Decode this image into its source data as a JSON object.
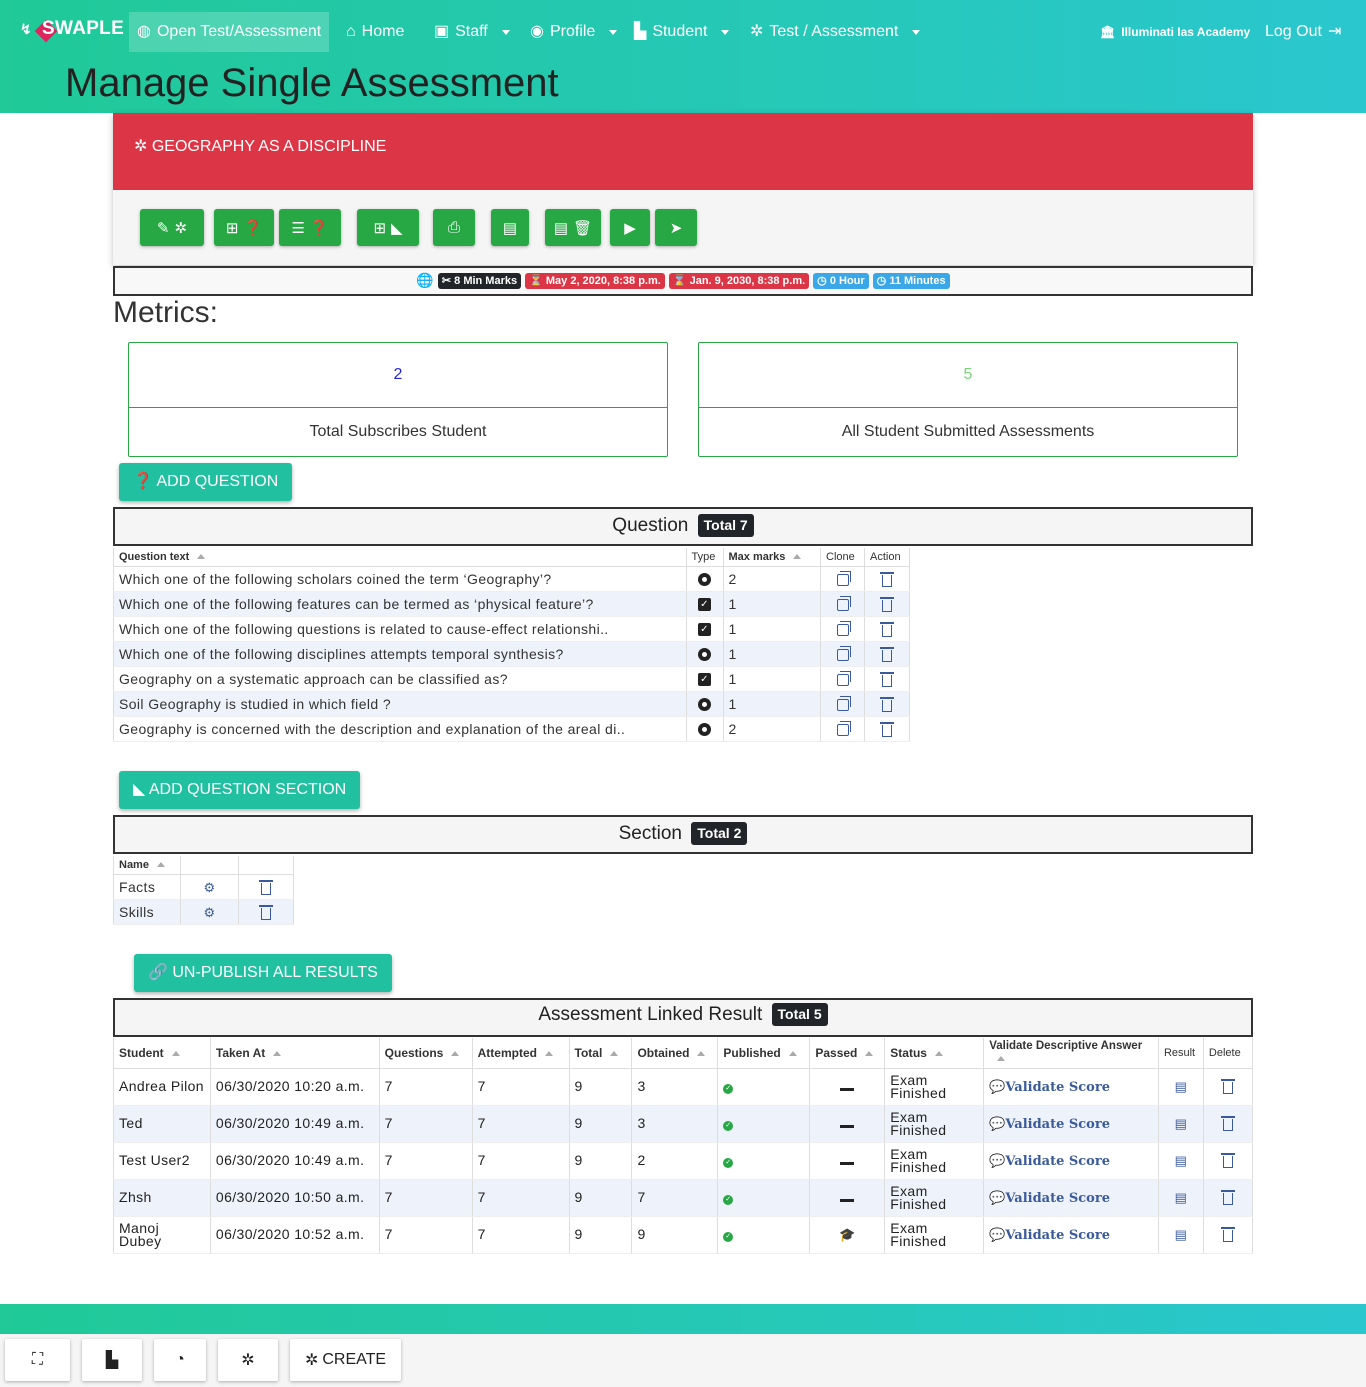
{
  "nav": {
    "brand": "SWAPLE",
    "open_test": "Open Test/Assessment",
    "home": "Home",
    "staff": "Staff",
    "profile": "Profile",
    "student": "Student",
    "test": "Test / Assessment",
    "academy": "Illuminati Ias Academy",
    "logout": "Log Out"
  },
  "page_title": "Manage Single Assessment",
  "assessment": {
    "title": "GEOGRAPHY AS A DISCIPLINE",
    "min_marks": "8 Min Marks",
    "start": "May 2, 2020, 8:38 p.m.",
    "end": "Jan. 9, 2030, 8:38 p.m.",
    "hours": "0 Hour",
    "minutes": "11 Minutes"
  },
  "metrics": {
    "title": "Metrics:",
    "subscribed_value": "2",
    "subscribed_label": "Total Subscribes Student",
    "submitted_value": "5",
    "submitted_label": "All Student Submitted Assessments"
  },
  "questions": {
    "add_button": "ADD QUESTION",
    "title": "Question",
    "total": "Total 7",
    "headers": [
      "Question text",
      "Type",
      "Max marks",
      "Clone",
      "Action"
    ],
    "rows": [
      {
        "text": "Which one of the following scholars coined the term ‘Geography’?",
        "type": "radio",
        "marks": "2"
      },
      {
        "text": "Which one of the following features can be termed as ‘physical feature’?",
        "type": "checkbox",
        "marks": "1"
      },
      {
        "text": "Which one of the following questions is related to cause-effect relationshi..",
        "type": "checkbox",
        "marks": "1"
      },
      {
        "text": "Which one of the following disciplines attempts temporal synthesis?",
        "type": "radio",
        "marks": "1"
      },
      {
        "text": "Geography on a systematic approach can be classified as?",
        "type": "checkbox",
        "marks": "1"
      },
      {
        "text": "Soil Geography is studied in which field ?",
        "type": "radio",
        "marks": "1"
      },
      {
        "text": "Geography is concerned with the description and explanation of the areal di..",
        "type": "radio",
        "marks": "2"
      }
    ]
  },
  "sections": {
    "add_button": "ADD QUESTION SECTION",
    "title": "Section",
    "total": "Total 2",
    "header": "Name",
    "rows": [
      {
        "name": "Facts"
      },
      {
        "name": "Skills"
      }
    ]
  },
  "results": {
    "unpublish_button": "UN-PUBLISH ALL RESULTS",
    "title": "Assessment Linked Result",
    "total": "Total 5",
    "headers": [
      "Student",
      "Taken At",
      "Questions",
      "Attempted",
      "Total",
      "Obtained",
      "Published",
      "Passed",
      "Status",
      "Validate Descriptive Answer",
      "Result",
      "Delete"
    ],
    "validate_label": "Validate Score",
    "rows": [
      {
        "student": "Andrea Pilon",
        "taken": "06/30/2020 10:20 a.m.",
        "questions": "7",
        "attempted": "7",
        "total": "9",
        "obtained": "3",
        "passed": "dash",
        "status": "Exam Finished"
      },
      {
        "student": "Ted",
        "taken": "06/30/2020 10:49 a.m.",
        "questions": "7",
        "attempted": "7",
        "total": "9",
        "obtained": "3",
        "passed": "dash",
        "status": "Exam Finished"
      },
      {
        "student": "Test User2",
        "taken": "06/30/2020 10:49 a.m.",
        "questions": "7",
        "attempted": "7",
        "total": "9",
        "obtained": "2",
        "passed": "dash",
        "status": "Exam Finished"
      },
      {
        "student": "Zhsh",
        "taken": "06/30/2020 10:50 a.m.",
        "questions": "7",
        "attempted": "7",
        "total": "9",
        "obtained": "7",
        "passed": "dash",
        "status": "Exam Finished"
      },
      {
        "student": "Manoj Dubey",
        "taken": "06/30/2020 10:52 a.m.",
        "questions": "7",
        "attempted": "7",
        "total": "9",
        "obtained": "9",
        "passed": "graduation-cap",
        "status": "Exam Finished"
      }
    ]
  },
  "footer": {
    "create": "CREATE"
  },
  "colors": {
    "nav": "#20c997",
    "header_red": "#dc3545",
    "button_green": "#28a745",
    "button_teal": "#20c0a0"
  }
}
